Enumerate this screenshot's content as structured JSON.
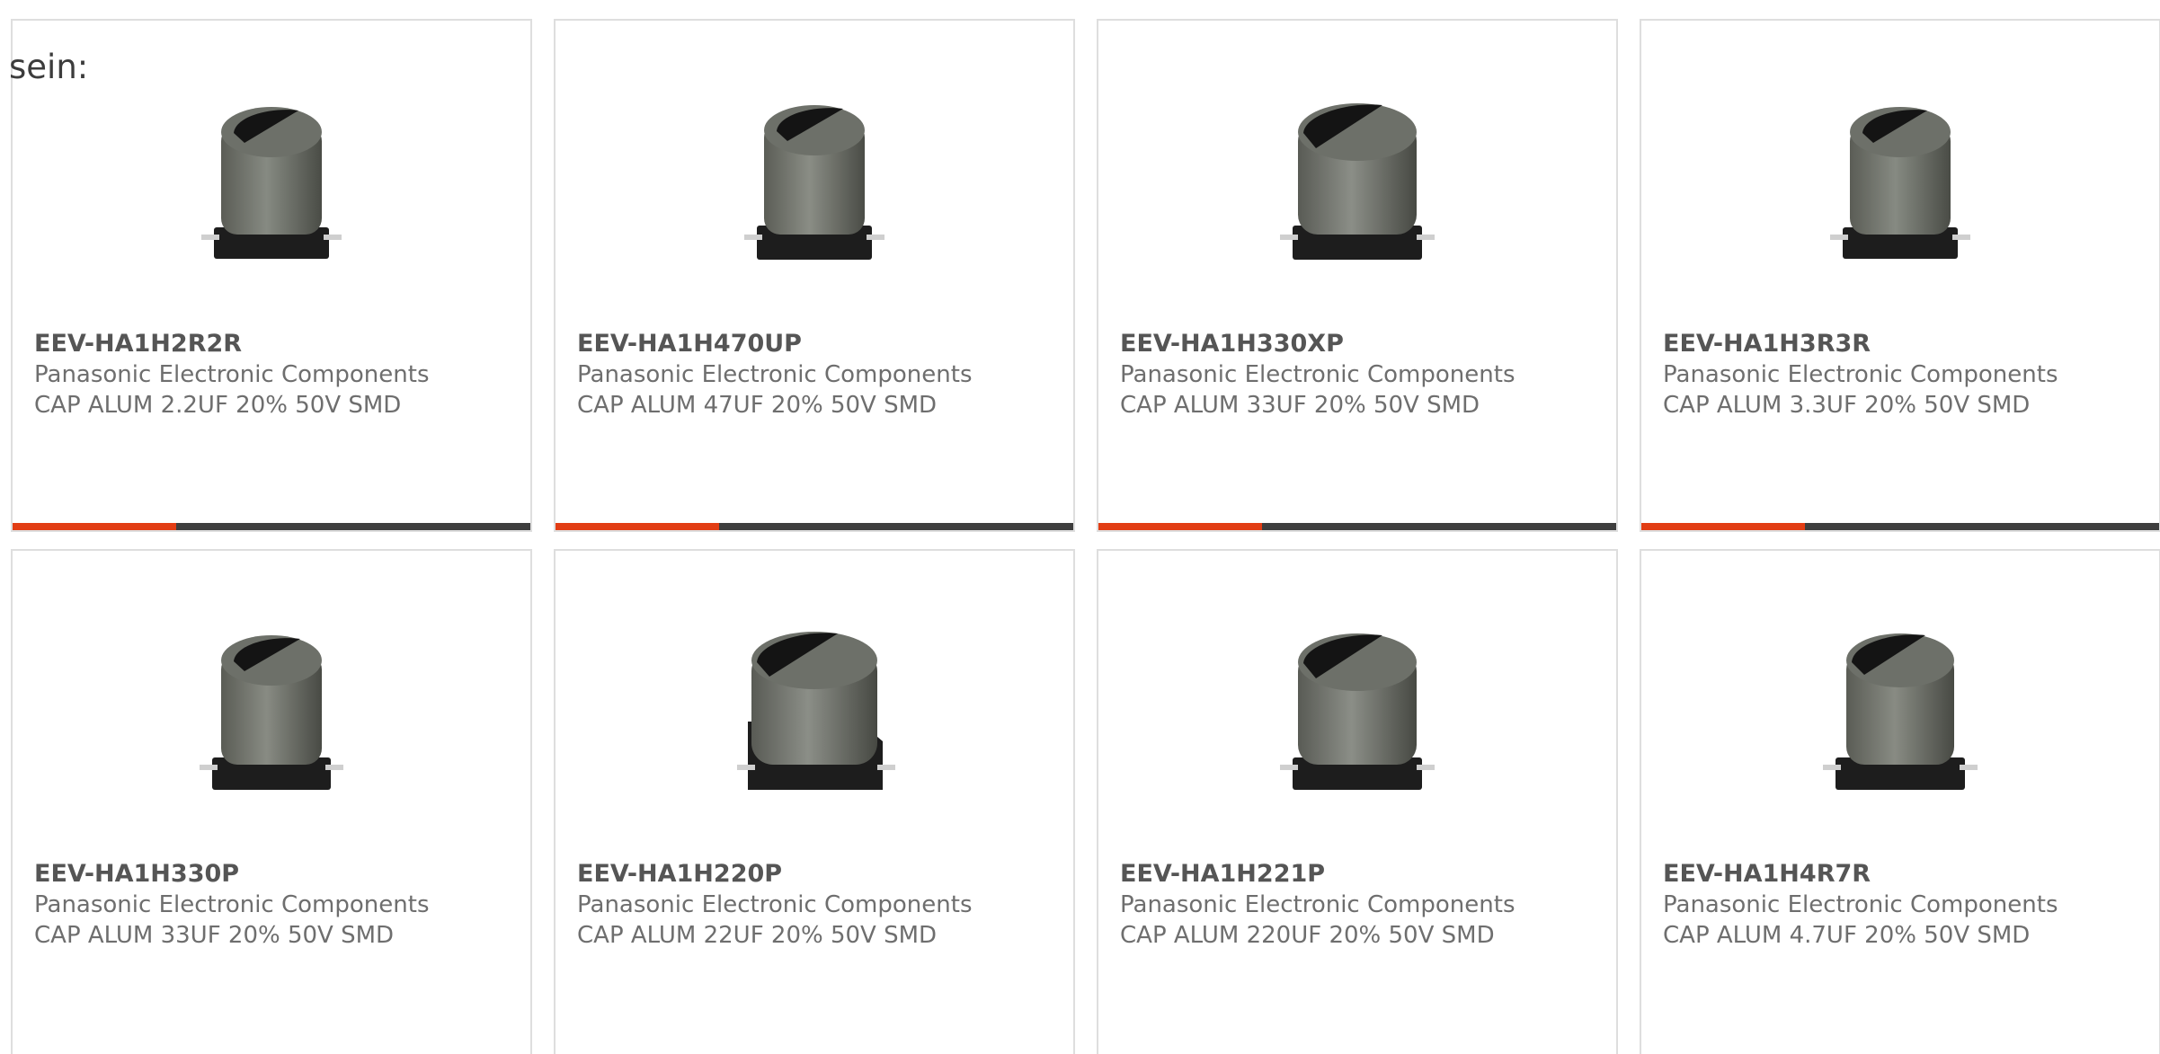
{
  "intro_text": "sein:",
  "colors": {
    "accent": "#e23d14",
    "bar": "#3e3e3e",
    "border": "#dedede"
  },
  "products": [
    {
      "part_number": "EEV-HA1H2R2R",
      "manufacturer": "Panasonic Electronic Components",
      "description": "CAP ALUM 2.2UF 20% 50V SMD",
      "image_icon": "smd-capacitor-image"
    },
    {
      "part_number": "EEV-HA1H470UP",
      "manufacturer": "Panasonic Electronic Components",
      "description": "CAP ALUM 47UF 20% 50V SMD",
      "image_icon": "smd-capacitor-image"
    },
    {
      "part_number": "EEV-HA1H330XP",
      "manufacturer": "Panasonic Electronic Components",
      "description": "CAP ALUM 33UF 20% 50V SMD",
      "image_icon": "smd-capacitor-image"
    },
    {
      "part_number": "EEV-HA1H3R3R",
      "manufacturer": "Panasonic Electronic Components",
      "description": "CAP ALUM 3.3UF 20% 50V SMD",
      "image_icon": "smd-capacitor-image"
    },
    {
      "part_number": "EEV-HA1H330P",
      "manufacturer": "Panasonic Electronic Components",
      "description": "CAP ALUM 33UF 20% 50V SMD",
      "image_icon": "smd-capacitor-image"
    },
    {
      "part_number": "EEV-HA1H220P",
      "manufacturer": "Panasonic Electronic Components",
      "description": "CAP ALUM 22UF 20% 50V SMD",
      "image_icon": "smd-capacitor-image"
    },
    {
      "part_number": "EEV-HA1H221P",
      "manufacturer": "Panasonic Electronic Components",
      "description": "CAP ALUM 220UF 20% 50V SMD",
      "image_icon": "smd-capacitor-image"
    },
    {
      "part_number": "EEV-HA1H4R7R",
      "manufacturer": "Panasonic Electronic Components",
      "description": "CAP ALUM 4.7UF 20% 50V SMD",
      "image_icon": "smd-capacitor-image"
    }
  ]
}
